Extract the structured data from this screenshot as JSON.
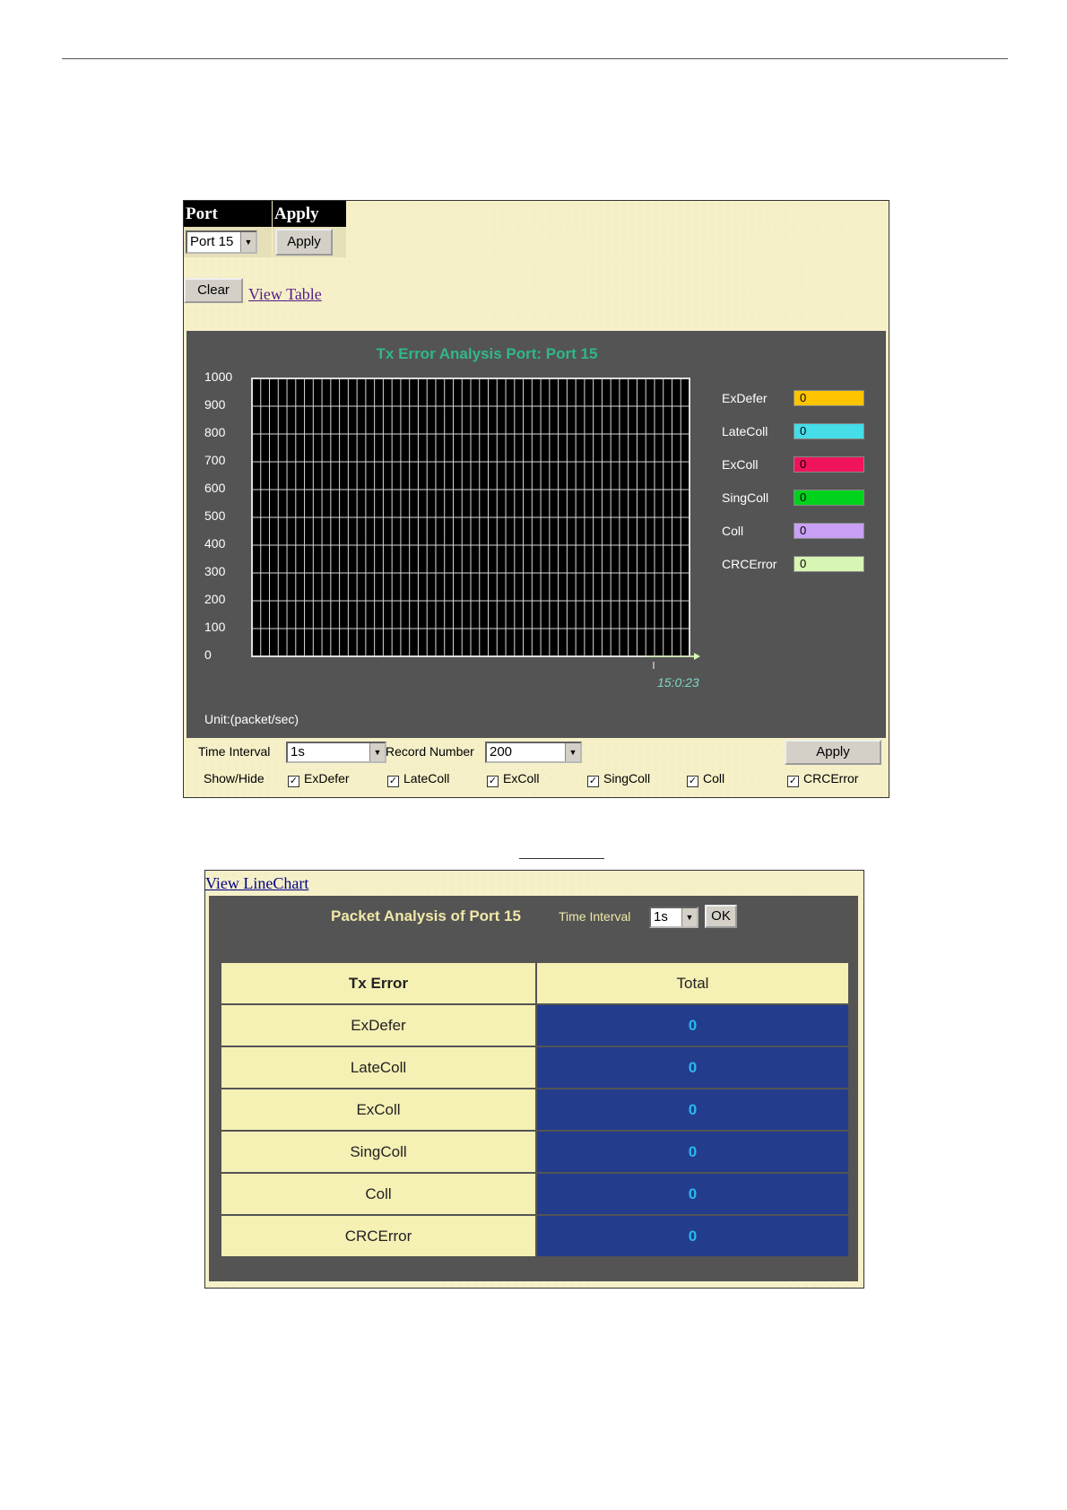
{
  "top_panel": {
    "header": {
      "port_label": "Port",
      "apply_label": "Apply"
    },
    "port_select": {
      "value": "Port 15"
    },
    "apply_button": "Apply",
    "clear_button": "Clear",
    "view_table_link": "View Table"
  },
  "chart": {
    "title": "Tx Error Analysis  Port: Port 15",
    "unit": "Unit:(packet/sec)",
    "time_label": "15:0:23",
    "legend": [
      {
        "label": "ExDefer",
        "value": "0",
        "color": "#ffc400"
      },
      {
        "label": "LateColl",
        "value": "0",
        "color": "#44dde8"
      },
      {
        "label": "ExColl",
        "value": "0",
        "color": "#f0145a"
      },
      {
        "label": "SingColl",
        "value": "0",
        "color": "#00d21e"
      },
      {
        "label": "Coll",
        "value": "0",
        "color": "#c9a0f5"
      },
      {
        "label": "CRCError",
        "value": "0",
        "color": "#d8f5b4"
      }
    ]
  },
  "chart_data": {
    "type": "line",
    "title": "Tx Error Analysis  Port: Port 15",
    "ylabel": "Unit:(packet/sec)",
    "ylim": [
      0,
      1000
    ],
    "yticks": [
      "1000",
      "900",
      "800",
      "700",
      "600",
      "500",
      "400",
      "300",
      "200",
      "100",
      "0"
    ],
    "x": [
      "15:0:23"
    ],
    "series": [
      {
        "name": "ExDefer",
        "values": [
          0
        ]
      },
      {
        "name": "LateColl",
        "values": [
          0
        ]
      },
      {
        "name": "ExColl",
        "values": [
          0
        ]
      },
      {
        "name": "SingColl",
        "values": [
          0
        ]
      },
      {
        "name": "Coll",
        "values": [
          0
        ]
      },
      {
        "name": "CRCError",
        "values": [
          0
        ]
      }
    ],
    "grid": true,
    "legend_position": "right"
  },
  "controls": {
    "time_interval_label": "Time Interval",
    "time_interval_value": "1s",
    "record_number_label": "Record Number",
    "record_number_value": "200",
    "apply_button": "Apply",
    "show_hide_label": "Show/Hide",
    "checkboxes": [
      {
        "label": "ExDefer",
        "checked": true
      },
      {
        "label": "LateColl",
        "checked": true
      },
      {
        "label": "ExColl",
        "checked": true
      },
      {
        "label": "SingColl",
        "checked": true
      },
      {
        "label": "Coll",
        "checked": true
      },
      {
        "label": "CRCError",
        "checked": true
      }
    ]
  },
  "table_panel": {
    "view_linechart_link": "View LineChart",
    "title": "Packet Analysis of Port 15",
    "time_interval_label": "Time Interval",
    "time_interval_value": "1s",
    "ok_button": "OK",
    "headers": [
      "Tx Error",
      "Total"
    ],
    "rows": [
      {
        "name": "ExDefer",
        "total": "0"
      },
      {
        "name": "LateColl",
        "total": "0"
      },
      {
        "name": "ExColl",
        "total": "0"
      },
      {
        "name": "SingColl",
        "total": "0"
      },
      {
        "name": "Coll",
        "total": "0"
      },
      {
        "name": "CRCError",
        "total": "0"
      }
    ]
  }
}
